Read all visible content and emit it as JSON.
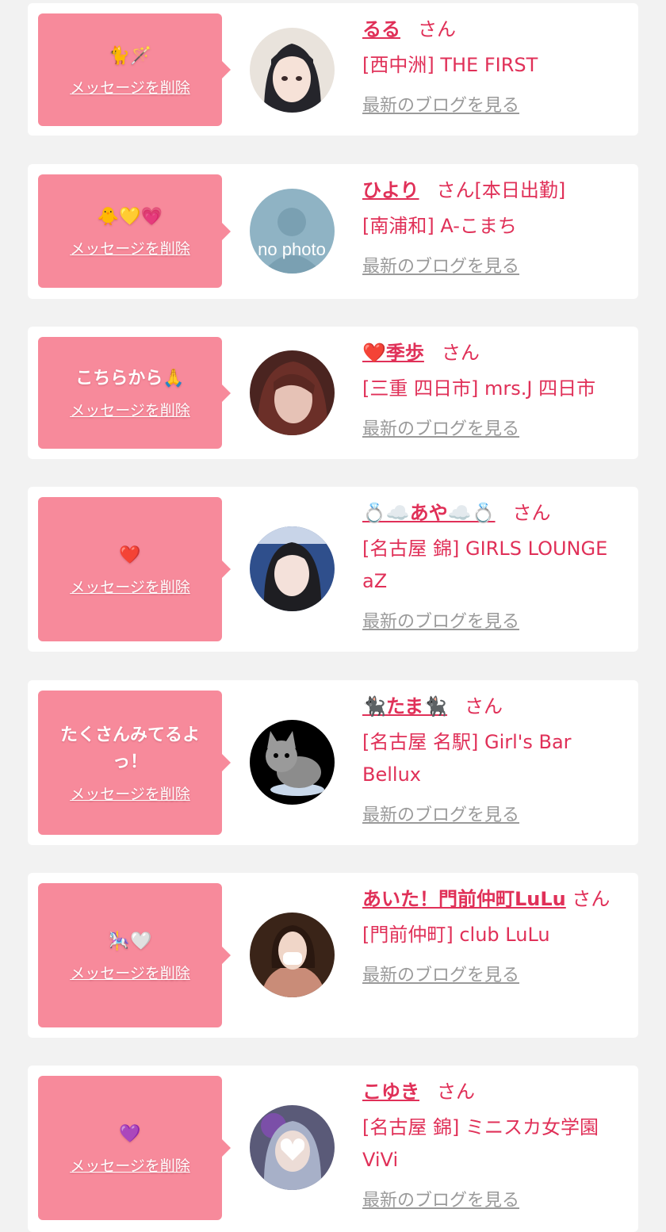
{
  "common": {
    "san": "さん",
    "delete_label": "メッセージを削除",
    "blog_label": "最新のブログを見る"
  },
  "cards": [
    {
      "message": "🐈🪄",
      "name": "るる",
      "tag": "",
      "shop": "[西中洲] THE FIRST"
    },
    {
      "message": "🐥💛💗",
      "name": "ひより",
      "tag": "[本日出勤]",
      "shop": "[南浦和] A-こまち",
      "avatar_text": "no photo"
    },
    {
      "message": "こちらから🙏",
      "name": "❤️季歩",
      "tag": "",
      "shop": "[三重 四日市] mrs.J 四日市"
    },
    {
      "message": "❤️",
      "name": "💍☁️あや☁️💍",
      "tag": "",
      "shop": "[名古屋 錦] GIRLS LOUNGE aZ"
    },
    {
      "message": "たくさんみてるよっ！",
      "name": "🐈‍⬛たま🐈‍⬛",
      "tag": "",
      "shop": "[名古屋 名駅] Girl's Bar Bellux"
    },
    {
      "message": "🎠🤍",
      "name": "あいた！門前仲町LuLu",
      "tag": "",
      "shop": "[門前仲町] club LuLu"
    },
    {
      "message": "💜",
      "name": "こゆき",
      "tag": "",
      "shop": "[名古屋 錦] ミニスカ女学園ViVi"
    }
  ]
}
